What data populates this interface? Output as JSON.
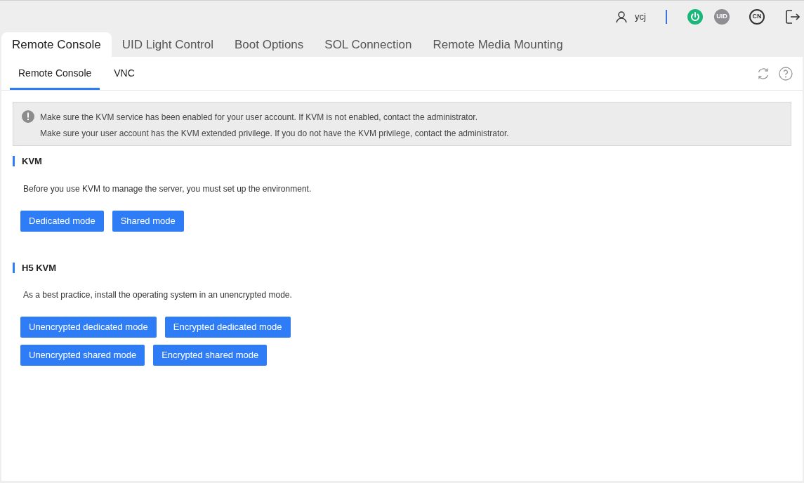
{
  "header": {
    "user": "ycj",
    "uid_badge": "UID",
    "language": "CN"
  },
  "tabs": [
    {
      "label": "Remote Console",
      "selected": true
    },
    {
      "label": "UID Light Control",
      "selected": false
    },
    {
      "label": "Boot Options",
      "selected": false
    },
    {
      "label": "SOL Connection",
      "selected": false
    },
    {
      "label": "Remote Media Mounting",
      "selected": false
    }
  ],
  "subtabs": [
    {
      "label": "Remote Console",
      "selected": true
    },
    {
      "label": "VNC",
      "selected": false
    }
  ],
  "notice": [
    "Make sure the KVM service has been enabled for your user account. If KVM is not enabled, contact the administrator.",
    "Make sure your user account has the KVM extended privilege. If you do not have the KVM privilege, contact the administrator."
  ],
  "sections": [
    {
      "title": "KVM",
      "description": "Before you use KVM to manage the server, you must set up the environment.",
      "button_rows": [
        [
          "Dedicated mode",
          "Shared mode"
        ]
      ]
    },
    {
      "title": "H5 KVM",
      "description": "As a best practice, install the operating system in an unencrypted mode.",
      "button_rows": [
        [
          "Unencrypted dedicated mode",
          "Encrypted dedicated mode"
        ],
        [
          "Unencrypted shared mode",
          "Encrypted shared mode"
        ]
      ]
    }
  ]
}
